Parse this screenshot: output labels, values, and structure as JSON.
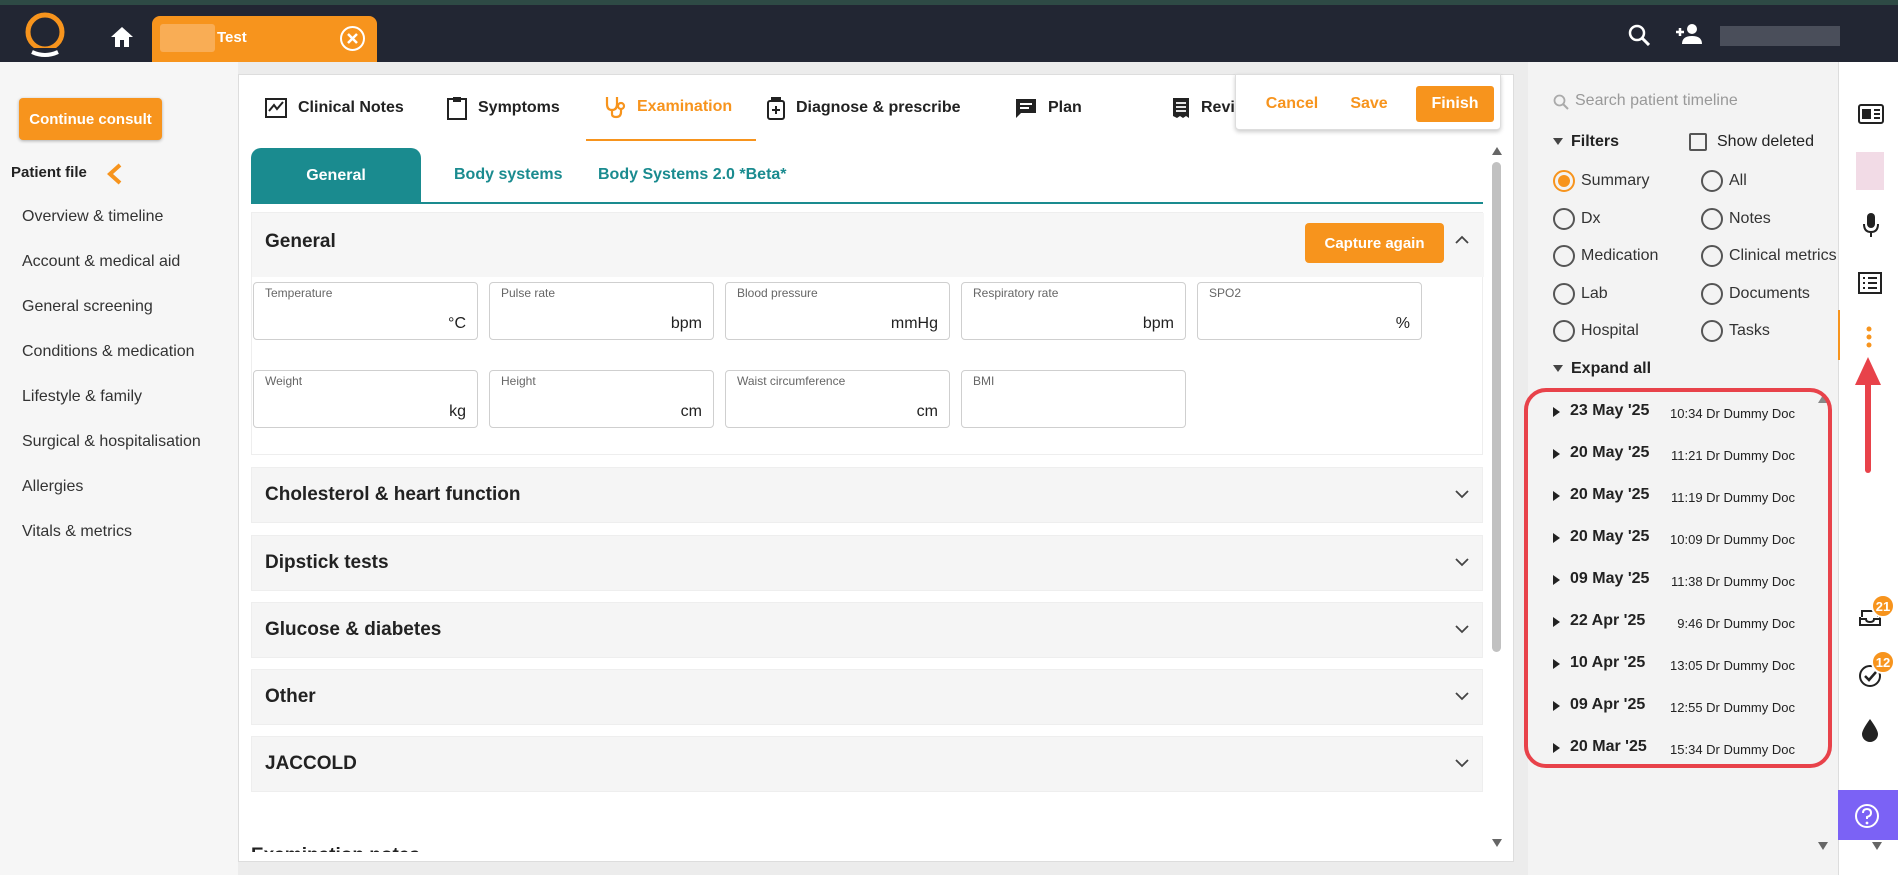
{
  "topbar": {
    "patient_tab_label": "Test"
  },
  "left_panel": {
    "continue_label": "Continue consult",
    "patient_file_label": "Patient file",
    "nav_items": [
      "Overview & timeline",
      "Account & medical aid",
      "General screening",
      "Conditions & medication",
      "Lifestyle & family",
      "Surgical & hospitalisation",
      "Allergies",
      "Vitals & metrics"
    ]
  },
  "tabs": {
    "clinical_notes": "Clinical Notes",
    "symptoms": "Symptoms",
    "examination": "Examination",
    "diagnose": "Diagnose & prescribe",
    "plan": "Plan",
    "review": "Revi"
  },
  "actions": {
    "cancel": "Cancel",
    "save": "Save",
    "finish": "Finish"
  },
  "subtabs": {
    "general": "General",
    "body_systems": "Body systems",
    "body_systems_2": "Body Systems 2.0 *Beta*"
  },
  "general_section": {
    "title": "General",
    "capture_label": "Capture again",
    "fields": [
      {
        "label": "Temperature",
        "unit": "°C"
      },
      {
        "label": "Pulse rate",
        "unit": "bpm"
      },
      {
        "label": "Blood pressure",
        "unit": "mmHg"
      },
      {
        "label": "Respiratory rate",
        "unit": "bpm"
      },
      {
        "label": "SPO2",
        "unit": "%"
      },
      {
        "label": "Weight",
        "unit": "kg"
      },
      {
        "label": "Height",
        "unit": "cm"
      },
      {
        "label": "Waist circumference",
        "unit": "cm"
      },
      {
        "label": "BMI",
        "unit": ""
      }
    ]
  },
  "accordions": [
    "Cholesterol & heart function",
    "Dipstick tests",
    "Glucose & diabetes",
    "Other",
    "JACCOLD"
  ],
  "exam_notes_label": "Examination notes",
  "timeline": {
    "search_placeholder": "Search patient timeline",
    "filters_label": "Filters",
    "show_deleted_label": "Show deleted",
    "radio_left": [
      "Summary",
      "Dx",
      "Medication",
      "Lab",
      "Hospital"
    ],
    "radio_right": [
      "All",
      "Notes",
      "Clinical metrics",
      "Documents",
      "Tasks"
    ],
    "selected": "Summary",
    "expand_all_label": "Expand all",
    "entries": [
      {
        "date": "23 May '25",
        "time": "10:34 Dr Dummy Doc"
      },
      {
        "date": "20 May '25",
        "time": "11:21 Dr Dummy Doc"
      },
      {
        "date": "20 May '25",
        "time": "11:19 Dr Dummy Doc"
      },
      {
        "date": "20 May '25",
        "time": "10:09 Dr Dummy Doc"
      },
      {
        "date": "09 May '25",
        "time": "11:38 Dr Dummy Doc"
      },
      {
        "date": "22 Apr '25",
        "time": "9:46 Dr Dummy Doc"
      },
      {
        "date": "10 Apr '25",
        "time": "13:05 Dr Dummy Doc"
      },
      {
        "date": "09 Apr '25",
        "time": "12:55 Dr Dummy Doc"
      },
      {
        "date": "20 Mar '25",
        "time": "15:34 Dr Dummy Doc"
      }
    ]
  },
  "rail": {
    "badge_inbox": "21",
    "badge_tasks": "12"
  },
  "colors": {
    "accent": "#f7941d",
    "teal": "#1a8b8f",
    "topbar": "#222633",
    "highlight": "#e8424a",
    "help": "#7b62f5"
  }
}
